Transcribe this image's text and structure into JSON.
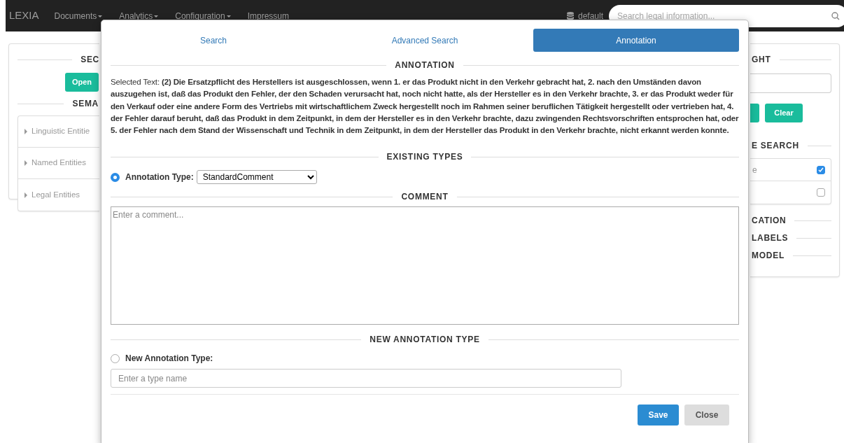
{
  "navbar": {
    "brand": "LEXIA",
    "menus": [
      {
        "label": "Documents",
        "dropdown": true
      },
      {
        "label": "Analytics",
        "dropdown": true
      },
      {
        "label": "Configuration",
        "dropdown": true
      },
      {
        "label": "Impressum",
        "dropdown": false
      }
    ],
    "database": "default",
    "search": {
      "placeholder": "Search legal information..."
    }
  },
  "left_panel": {
    "heading_1": "SEC",
    "open_button": "Open",
    "heading_2": "SEMA",
    "entities": [
      {
        "label": "Linguistic Entitie"
      },
      {
        "label": "Named Entities"
      },
      {
        "label": "Legal Entities"
      }
    ]
  },
  "right_panel": {
    "heading_1": "GHT",
    "clear_button": "Clear",
    "heading_2": "E SEARCH",
    "options": [
      {
        "label": "e",
        "checked": true
      },
      {
        "checked": false
      }
    ],
    "headings": [
      "CATION",
      "LABELS",
      "MODEL"
    ]
  },
  "modal": {
    "tabs": [
      {
        "label": "Search",
        "selected": false
      },
      {
        "label": "Advanced Search",
        "selected": false
      },
      {
        "label": "Annotation",
        "selected": true
      }
    ],
    "annotation_heading": "ANNOTATION",
    "selected_text": "Selected Text: **(2) Die Ersatzpflicht des Herstellers ist ausgeschlossen, wenn 1. er das Produkt nicht in den Verkehr gebracht hat, 2. nach den Umständen davon auszugehen ist, daß das Produkt den Fehler, der den Schaden verursacht hat, noch nicht hatte, als der Hersteller es in den Verkehr brachte, 3. er das Produkt weder für den Verkauf oder eine andere Form des Vertriebs mit wirtschaftlichem Zweck hergestellt noch im Rahmen seiner beruflichen Tätigkeit hergestellt oder vertrieben hat, 4. der Fehler darauf beruht, daß das Produkt in dem Zeitpunkt, in dem der Hersteller es in den Verkehr brachte, dazu zwingenden Rechtsvorschriften entsprochen hat, oder 5. der Fehler nach dem Stand der Wissenschaft und Technik in dem Zeitpunkt, in dem der Hersteller das Produkt in den Verkehr brachte, nicht erkannt werden konnte.**",
    "existing_types_heading": "EXISTING TYPES",
    "existing_type": {
      "label": "Annotation Type:",
      "selected": true,
      "value": "StandardComment"
    },
    "comment_heading": "COMMENT",
    "comment": {
      "placeholder": "Enter a comment..."
    },
    "new_type_heading": "NEW ANNOTATION TYPE",
    "new_type": {
      "label": "New Annotation Type:",
      "selected": false,
      "placeholder": "Enter a type name"
    },
    "buttons": [
      {
        "label": "Save",
        "kind": "primary"
      },
      {
        "label": "Close",
        "kind": "secondary"
      }
    ]
  }
}
